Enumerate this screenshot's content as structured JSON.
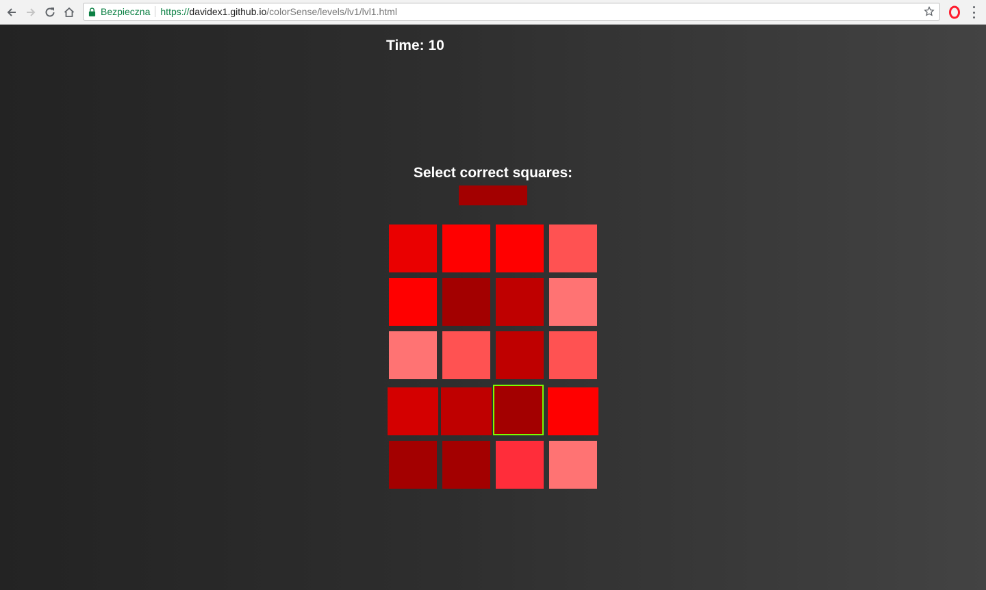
{
  "browser": {
    "security_label": "Bezpieczna",
    "url_scheme": "https://",
    "url_host": "davidex1.github.io",
    "url_path": "/colorSense/levels/lv1/lvl1.html",
    "icons": [
      "back-icon",
      "forward-icon",
      "reload-icon",
      "home-icon",
      "lock-icon",
      "bookmark-star-icon",
      "opera-icon",
      "menu-icon"
    ]
  },
  "game": {
    "timer_text": "Time: 10",
    "instruction": "Select correct squares:",
    "target_color": "#a30000",
    "selected_border_color": "#7cfc00",
    "grid": {
      "rows": 5,
      "cols": 4,
      "tiles": [
        {
          "color": "#ea0000",
          "selected": false
        },
        {
          "color": "#ff0000",
          "selected": false
        },
        {
          "color": "#ff0000",
          "selected": false
        },
        {
          "color": "#ff5252",
          "selected": false
        },
        {
          "color": "#ff0000",
          "selected": false
        },
        {
          "color": "#a30000",
          "selected": false
        },
        {
          "color": "#bf0000",
          "selected": false
        },
        {
          "color": "#ff7373",
          "selected": false
        },
        {
          "color": "#ff7373",
          "selected": false
        },
        {
          "color": "#ff5252",
          "selected": false
        },
        {
          "color": "#bf0000",
          "selected": false
        },
        {
          "color": "#ff5252",
          "selected": false
        },
        {
          "color": "#d40000",
          "selected": false
        },
        {
          "color": "#bf0000",
          "selected": false
        },
        {
          "color": "#a30000",
          "selected": true
        },
        {
          "color": "#ff0000",
          "selected": false
        },
        {
          "color": "#a30000",
          "selected": false
        },
        {
          "color": "#a30000",
          "selected": false
        },
        {
          "color": "#ff2d3a",
          "selected": false
        },
        {
          "color": "#ff7373",
          "selected": false
        }
      ]
    }
  }
}
